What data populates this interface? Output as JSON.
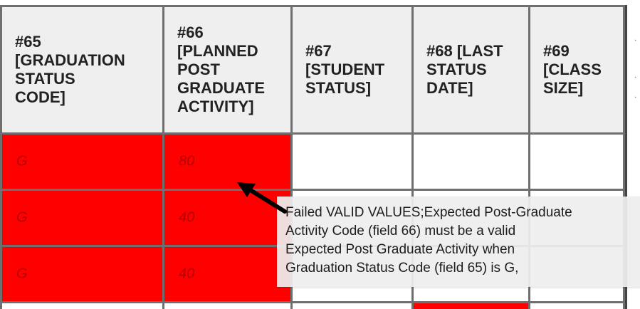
{
  "table": {
    "headers": [
      {
        "lines": [
          "#65",
          "[GRADUATION",
          "STATUS",
          "CODE]"
        ]
      },
      {
        "lines": [
          "#66",
          "[PLANNED",
          "POST",
          "GRADUATE",
          "ACTIVITY]"
        ]
      },
      {
        "lines": [
          "#67",
          "[STUDENT",
          "STATUS]"
        ]
      },
      {
        "lines": [
          "#68 [LAST",
          "STATUS",
          "DATE]"
        ]
      },
      {
        "lines": [
          "#69",
          "[CLASS",
          "SIZE]"
        ]
      }
    ],
    "rows": [
      {
        "cells": [
          "G",
          "80",
          "",
          "",
          ""
        ]
      },
      {
        "cells": [
          "G",
          "40",
          "",
          "",
          ""
        ]
      },
      {
        "cells": [
          "G",
          "40",
          "",
          "",
          ""
        ]
      }
    ]
  },
  "tooltip": {
    "lines": [
      "Failed VALID VALUES;Expected Post-Graduate",
      "Activity Code (field 66) must be a valid",
      "Expected Post Graduate Activity when",
      "Graduation Status Code (field 65) is G,"
    ]
  },
  "colors": {
    "error_fill": "#fe0000",
    "error_text": "#b10000",
    "grid_line": "#6f6f6f",
    "header_bg": "#efefef"
  },
  "icons": {
    "pointer": "arrow-pointer-icon"
  }
}
